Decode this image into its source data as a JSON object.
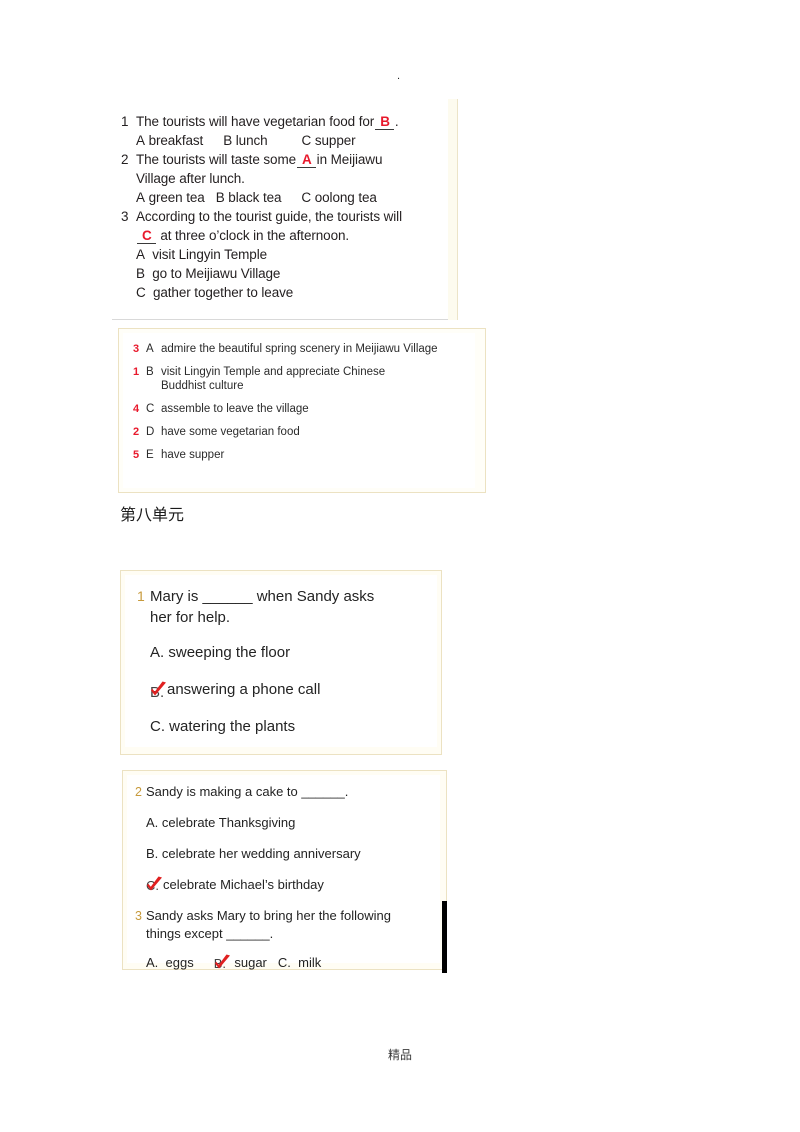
{
  "page": {
    "top_mark": ".",
    "footer": "精品",
    "unit_heading": "第八单元"
  },
  "colors": {
    "answer_red": "#e8192c",
    "check_red": "#e02020",
    "number_gold": "#c79a3c",
    "box_border_cream": "#ece2c2",
    "box_border_gray": "#d9d9d9"
  },
  "listening_box": {
    "questions": [
      {
        "number": "1",
        "stem_before": "The tourists will have vegetarian food for",
        "answer": "B",
        "stem_after": ".",
        "options_inline": [
          {
            "letter": "A",
            "text": "breakfast"
          },
          {
            "letter": "B",
            "text": "lunch"
          },
          {
            "letter": "C",
            "text": "supper"
          }
        ]
      },
      {
        "number": "2",
        "stem_before": "The tourists will taste some",
        "answer": "A",
        "stem_after": "in Meijiawu",
        "stem_line2": "Village after lunch.",
        "options_inline": [
          {
            "letter": "A",
            "text": "green tea"
          },
          {
            "letter": "B",
            "text": "black tea"
          },
          {
            "letter": "C",
            "text": "oolong tea"
          }
        ]
      },
      {
        "number": "3",
        "stem_before": "According to the tourist guide, the tourists will",
        "answer": "C",
        "stem_after": "at three o’clock in the afternoon.",
        "options_stacked": [
          {
            "letter": "A",
            "text": "visit Lingyin Temple"
          },
          {
            "letter": "B",
            "text": "go to Meijiawu Village"
          },
          {
            "letter": "C",
            "text": "gather together to leave"
          }
        ]
      }
    ]
  },
  "matching_box": {
    "items": [
      {
        "order": "3",
        "letter": "A",
        "text": "admire the beautiful spring scenery in Meijiawu Village"
      },
      {
        "order": "1",
        "letter": "B",
        "text": "visit Lingyin Temple and appreciate Chinese",
        "text_line2": "Buddhist culture"
      },
      {
        "order": "4",
        "letter": "C",
        "text": "assemble to leave the village"
      },
      {
        "order": "2",
        "letter": "D",
        "text": "have some vegetarian food"
      },
      {
        "order": "5",
        "letter": "E",
        "text": "have supper"
      }
    ]
  },
  "unit8_box1": {
    "question": {
      "number": "1",
      "stem_line1": "Mary is ______ when Sandy asks",
      "stem_line2": "her for help."
    },
    "choices": [
      {
        "label": "A.",
        "text": "sweeping the floor",
        "checked": false
      },
      {
        "label": "B.",
        "text": "answering a phone call",
        "checked": true
      },
      {
        "label": "C.",
        "text": "watering the plants",
        "checked": false
      }
    ]
  },
  "unit8_box2": {
    "question2": {
      "number": "2",
      "stem": "Sandy is making a cake to ______.",
      "choices": [
        {
          "label": "A.",
          "text": "celebrate Thanksgiving",
          "checked": false
        },
        {
          "label": "B.",
          "text": "celebrate her wedding anniversary",
          "checked": false
        },
        {
          "label": "C.",
          "text": "celebrate Michael’s birthday",
          "checked": true
        }
      ]
    },
    "question3": {
      "number": "3",
      "stem_line1": "Sandy asks Mary to bring her the following",
      "stem_line2": "things except ______.",
      "inline_choices": [
        {
          "label": "A.",
          "text": "eggs",
          "checked": false
        },
        {
          "label": "B.",
          "text": "sugar",
          "checked": true
        },
        {
          "label": "C.",
          "text": "milk",
          "checked": false
        }
      ]
    }
  }
}
